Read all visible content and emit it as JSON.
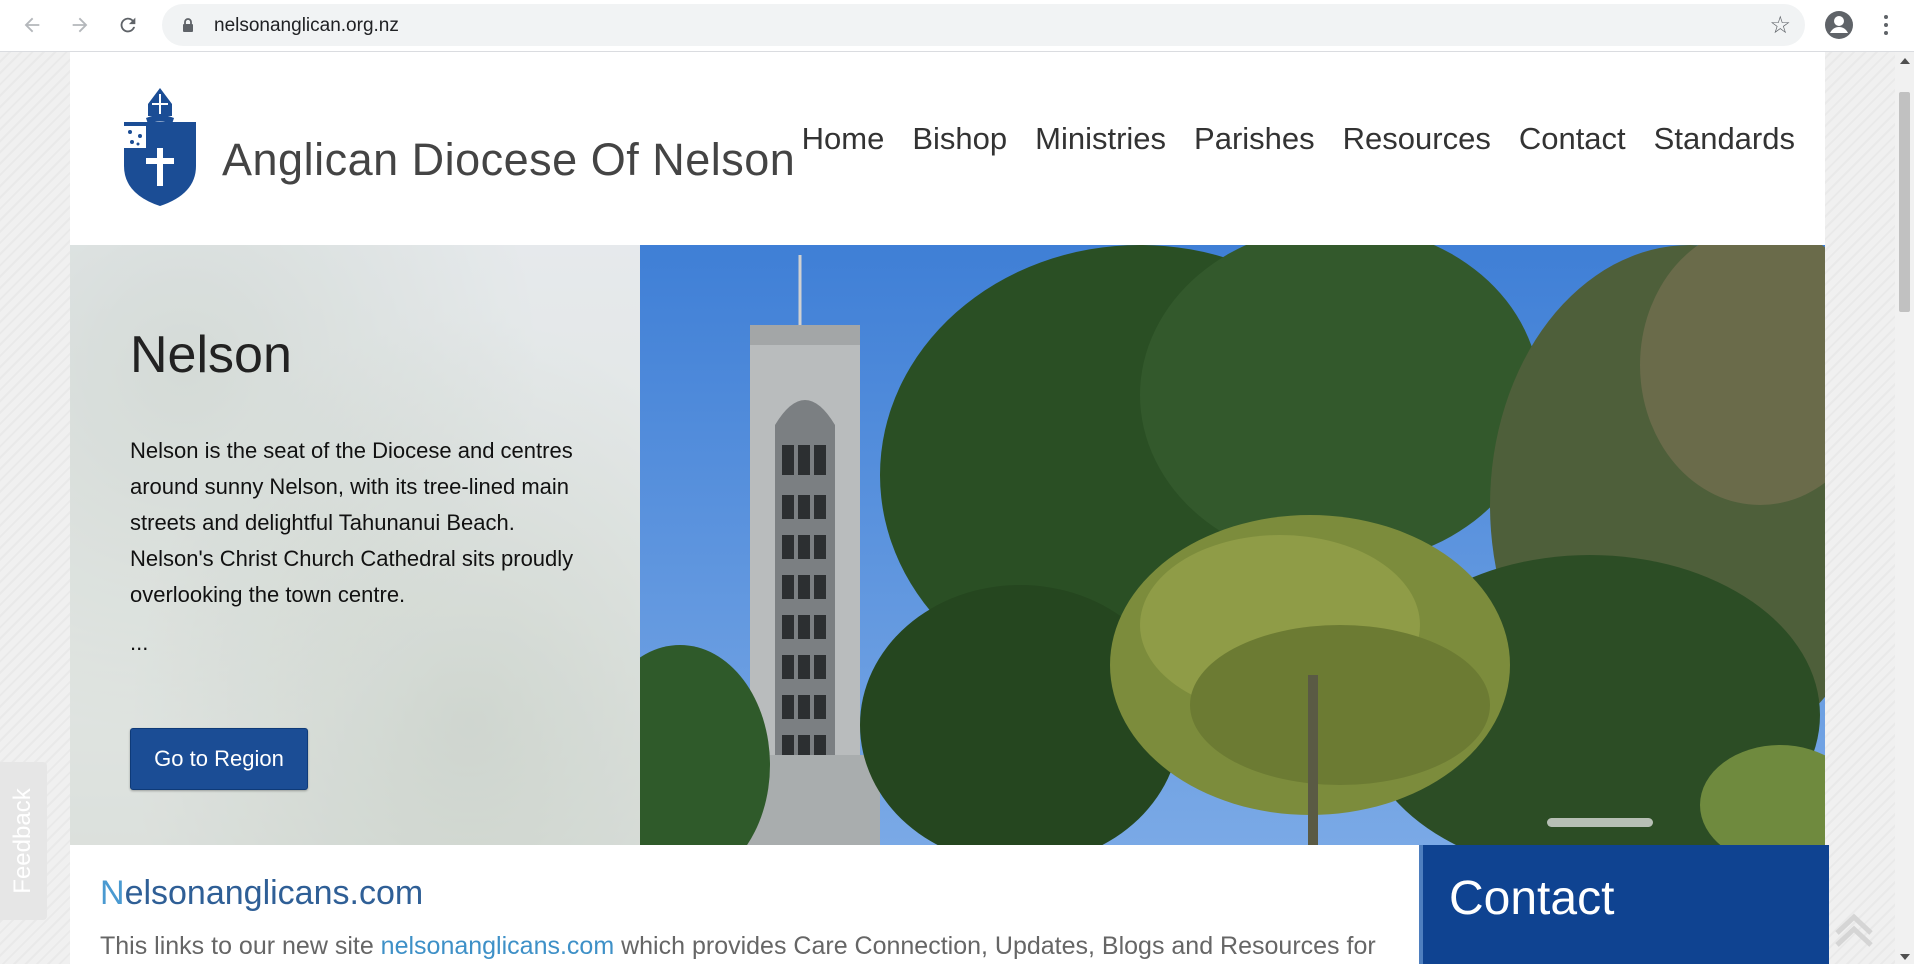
{
  "browser": {
    "url": "nelsonanglican.org.nz",
    "icons": {
      "back": "back-arrow-icon",
      "forward": "forward-arrow-icon",
      "reload": "reload-icon",
      "lock": "lock-icon",
      "bookmark": "star-icon",
      "profile": "profile-icon",
      "menu": "more-vert-icon"
    }
  },
  "site": {
    "title": "Anglican Diocese Of Nelson",
    "nav": [
      "Home",
      "Bishop",
      "Ministries",
      "Parishes",
      "Resources",
      "Contact",
      "Standards"
    ]
  },
  "hero": {
    "heading": "Nelson",
    "description": "Nelson is the seat of the Diocese and centres around sunny Nelson, with its tree-lined main streets and delightful Tahunanui Beach. Nelson's Christ Church Cathedral sits proudly overlooking the town centre.",
    "ellipsis": "...",
    "button": "Go to Region"
  },
  "section": {
    "heading_first": "N",
    "heading_rest": "elsonanglicans.com",
    "text_before": "This links to our new site ",
    "link": "nelsonanglicans.com",
    "text_after": " which provides Care Connection, Updates, Blogs and Resources for"
  },
  "contact": {
    "title": "Contact"
  },
  "feedback": {
    "label": "Feedback"
  },
  "colors": {
    "brand_blue": "#1b4d95",
    "contact_blue": "#0f4391",
    "link_blue": "#3e90c7"
  }
}
